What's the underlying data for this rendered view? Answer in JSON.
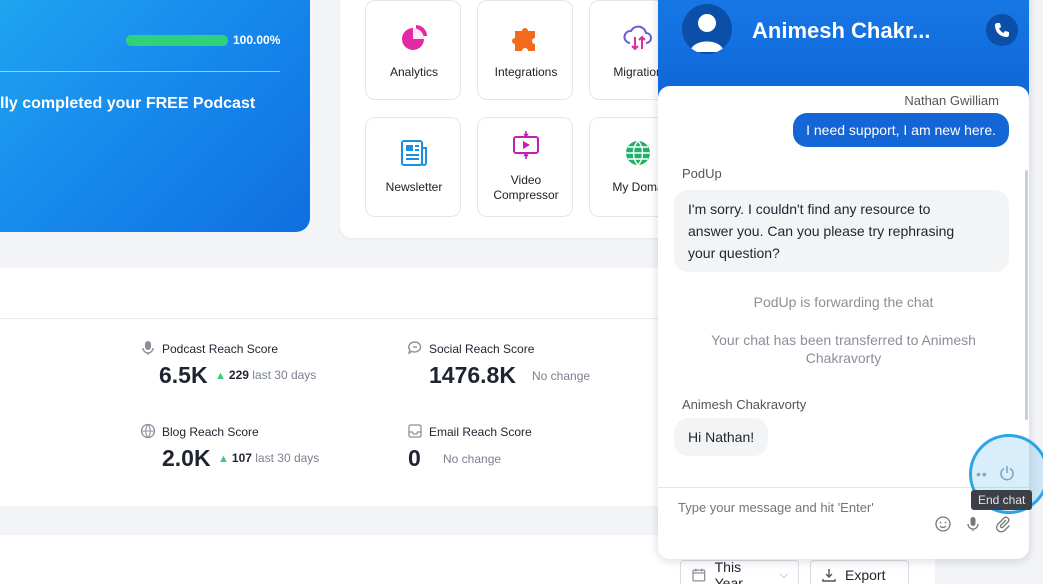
{
  "hero": {
    "progress_text": "100.00%",
    "progress_value": 1.0,
    "message": "lly completed your FREE Podcast"
  },
  "apps": [
    {
      "label": "Analytics",
      "icon": "pie-chart-icon",
      "color": "#e12aa4"
    },
    {
      "label": "Integrations",
      "icon": "puzzle-icon",
      "color": "#f26a1b"
    },
    {
      "label": "Migration",
      "icon": "cloud-sync-icon",
      "color": "#6b5fd9"
    },
    {
      "label": "Newsletter",
      "icon": "newsletter-icon",
      "color": "#1b8fe0"
    },
    {
      "label": "Video Compressor",
      "line1": "Video",
      "line2": "Compressor",
      "icon": "video-compress-icon",
      "color": "#c21fb6"
    },
    {
      "label": "My Doma",
      "icon": "globe-icon",
      "color": "#22b06a"
    }
  ],
  "stats": {
    "podcast": {
      "title": "Podcast Reach Score",
      "value": "6.5K",
      "delta": "229",
      "period": "last 30 days",
      "icon": "microphone-icon"
    },
    "social": {
      "title": "Social Reach Score",
      "value": "1476.8K",
      "status": "No change",
      "icon": "chat-bubble-icon"
    },
    "blog": {
      "title": "Blog Reach Score",
      "value": "2.0K",
      "delta": "107",
      "period": "last 30 days",
      "icon": "globe-icon"
    },
    "email": {
      "title": "Email Reach Score",
      "value": "0",
      "status": "No change",
      "icon": "inbox-icon"
    }
  },
  "bottom": {
    "period_button": "This Year",
    "export_button": "Export"
  },
  "chat": {
    "agent_name": "Animesh Chakr...",
    "messages": {
      "user_name": "Nathan Gwilliam",
      "user_text": "I need support, I am new here.",
      "bot_name": "PodUp",
      "bot_line1": "I'm sorry. I couldn't find any resource to",
      "bot_line2": "answer you. Can you please try rephrasing",
      "bot_line3": "your question?",
      "system1": "PodUp is forwarding the chat",
      "system2_line1": "Your chat has been transferred to Animesh",
      "system2_line2": "Chakravorty",
      "agent_full_name": "Animesh Chakravorty",
      "agent_text": "Hi Nathan!"
    },
    "composer_placeholder": "Type your message and hit 'Enter'",
    "end_chat_tooltip": "End chat",
    "brand_color": "#1466d6"
  }
}
